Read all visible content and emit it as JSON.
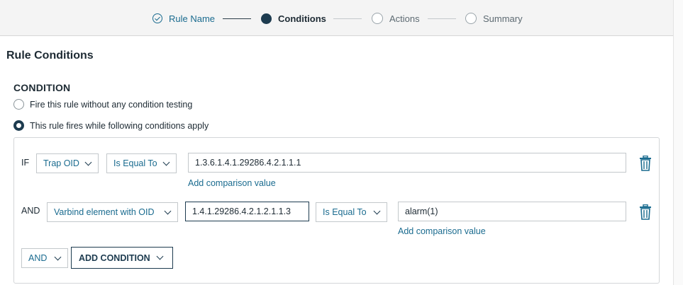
{
  "stepper": {
    "steps": [
      {
        "label": "Rule Name",
        "state": "done"
      },
      {
        "label": "Conditions",
        "state": "active"
      },
      {
        "label": "Actions",
        "state": "pending"
      },
      {
        "label": "Summary",
        "state": "pending"
      }
    ]
  },
  "page": {
    "title": "Rule Conditions",
    "section_title": "CONDITION"
  },
  "radios": [
    {
      "label": "Fire this rule without any condition testing",
      "checked": false
    },
    {
      "label": "This rule fires while following conditions apply",
      "checked": true
    }
  ],
  "conditions": [
    {
      "operator": "IF",
      "field": "Trap OID",
      "comparator": "Is Equal To",
      "value": "1.3.6.1.4.1.29286.4.2.1.1.1",
      "add_value_link": "Add comparison value"
    },
    {
      "operator": "AND",
      "field": "Varbind element with OID",
      "oid": "1.4.1.29286.4.2.1.2.1.1.3",
      "comparator": "Is Equal To",
      "value": "alarm(1)",
      "add_value_link": "Add comparison value"
    }
  ],
  "footer": {
    "join_select": "AND",
    "add_condition_label": "ADD CONDITION"
  },
  "icons": {
    "step_done": "check-circle-icon",
    "delete": "trash-icon",
    "dropdown": "chevron-down-icon"
  },
  "colors": {
    "accent": "#1a6b8f",
    "primary_dark": "#1d3b4f",
    "stepper_bg": "#f4f4f4"
  }
}
